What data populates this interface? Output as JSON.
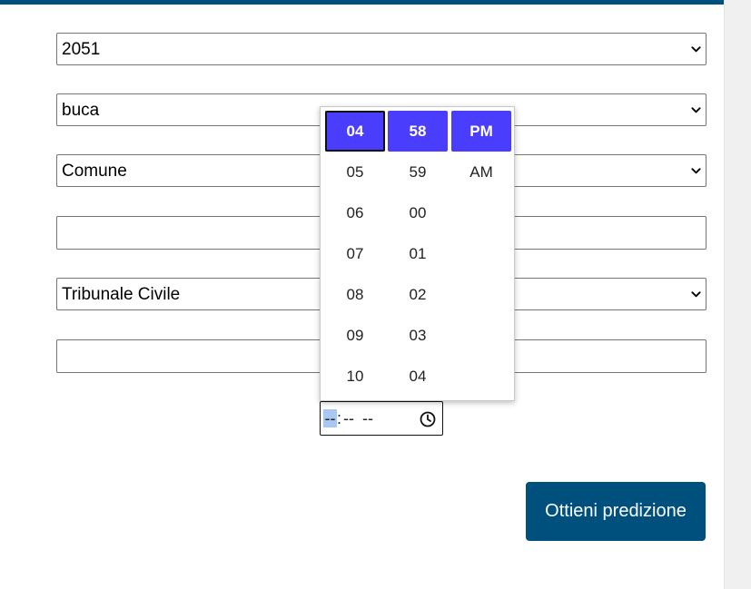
{
  "form": {
    "select_year": {
      "value": "2051"
    },
    "select_type": {
      "value": "buca"
    },
    "select_entity": {
      "value": "Comune"
    },
    "text_field_1": {
      "value": "",
      "placeholder": ""
    },
    "select_court": {
      "value": "Tribunale Civile"
    },
    "text_field_2": {
      "value": "",
      "placeholder": ""
    },
    "time_input": {
      "hours": "--",
      "separator": ":",
      "minutes": "--",
      "period": "--"
    },
    "submit_label": "Ottieni predizione"
  },
  "time_picker": {
    "hours": [
      "04",
      "05",
      "06",
      "07",
      "08",
      "09",
      "10"
    ],
    "minutes": [
      "58",
      "59",
      "00",
      "01",
      "02",
      "03",
      "04"
    ],
    "periods": [
      "PM",
      "AM"
    ],
    "selected_hour": "04",
    "selected_minute": "58",
    "selected_period": "PM"
  },
  "colors": {
    "brand": "#00507d",
    "picker_selected": "#4a3dfb",
    "focus_segment": "#a9c7f3"
  },
  "icons": {
    "select_arrow": "chevron-down-icon",
    "time": "clock-icon"
  }
}
